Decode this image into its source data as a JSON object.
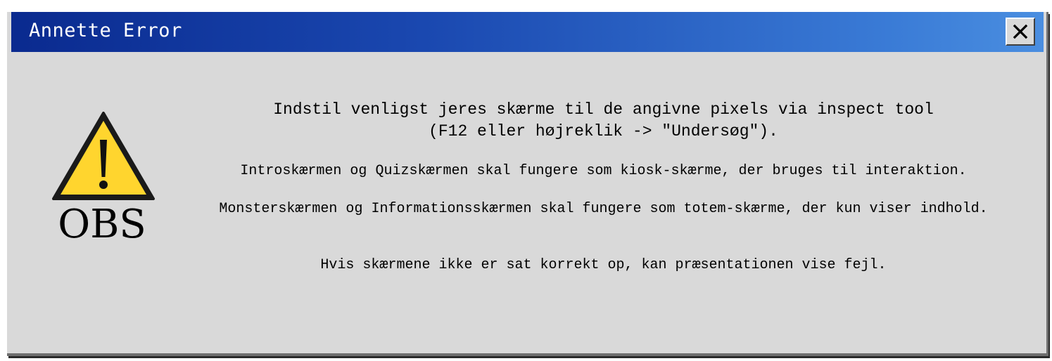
{
  "window": {
    "title": "Annette Error",
    "close_icon": "close-icon"
  },
  "alert": {
    "icon": "warning-triangle-icon",
    "icon_color": "#FFD52E",
    "label": "OBS"
  },
  "message": {
    "main_line1": "Indstil venligst jeres skærme til de angivne pixels via inspect tool",
    "main_line2": "(F12 eller højreklik -> \"Undersøg\").",
    "line1": "Introskærmen og Quizskærmen skal fungere som kiosk-skærme, der bruges til interaktion.",
    "line2": "Monsterskærmen og Informationsskærmen skal fungere som totem-skærme, der kun viser indhold.",
    "line3": "Hvis skærmene ikke er sat korrekt op, kan præsentationen vise fejl."
  },
  "colors": {
    "titlebar_start": "#0a2a8f",
    "titlebar_end": "#4a8ee0",
    "dialog_bg": "#d9d9d9"
  }
}
